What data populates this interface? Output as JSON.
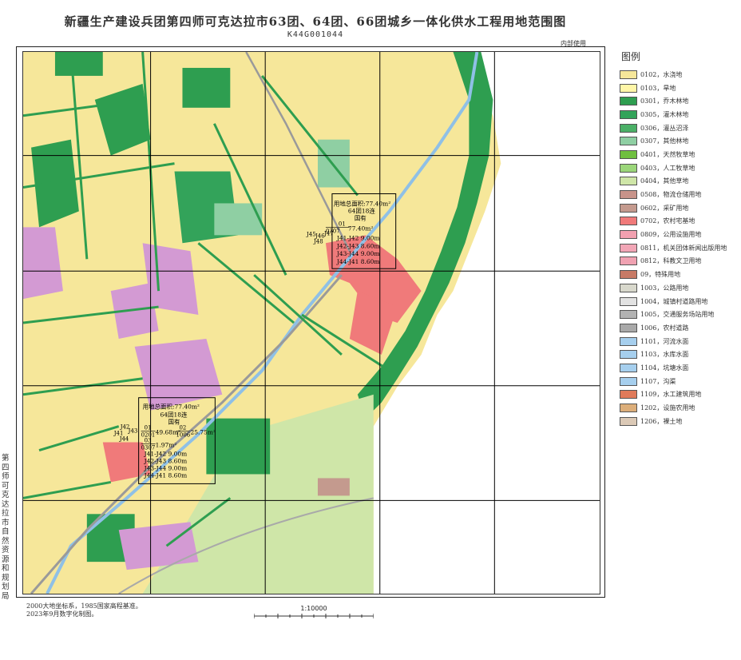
{
  "title": "新疆生产建设兵团第四师可克达拉市63团、64团、66团城乡一体化供水工程用地范围图",
  "map_code": "K44G001044",
  "internal_use": "内部使用",
  "side_authority": "第四师可克达拉市自然资源和规划局",
  "notes": [
    "2000大地坐标系，1985国家高程基准。",
    "2023年9月数字化制图。"
  ],
  "scale": "1:10000",
  "legend": {
    "title": "图例",
    "items": [
      {
        "code_label": "0102，水浇地",
        "color": "#f6e79a"
      },
      {
        "code_label": "0103，旱地",
        "color": "#fff6a8"
      },
      {
        "code_label": "0301，乔木林地",
        "color": "#2e9e50"
      },
      {
        "code_label": "0305，灌木林地",
        "color": "#33a35a"
      },
      {
        "code_label": "0306，灌丛沼泽",
        "color": "#4bb067"
      },
      {
        "code_label": "0307，其他林地",
        "color": "#8fcfa3"
      },
      {
        "code_label": "0401，天然牧草地",
        "color": "#6fbf3f"
      },
      {
        "code_label": "0403，人工牧草地",
        "color": "#9bd67a"
      },
      {
        "code_label": "0404，其他草地",
        "color": "#cfe6a8"
      },
      {
        "code_label": "0508，物流仓储用地",
        "color": "#c8938a"
      },
      {
        "code_label": "0602，采矿用地",
        "color": "#c49a8e"
      },
      {
        "code_label": "0702，农村宅基地",
        "color": "#f07a7a"
      },
      {
        "code_label": "0809，公用设施用地",
        "color": "#f2a0b0"
      },
      {
        "code_label": "0811，机关团体新闻出版用地",
        "color": "#f2a6b6"
      },
      {
        "code_label": "0812，科教文卫用地",
        "color": "#f0a2b2"
      },
      {
        "code_label": "09，特殊用地",
        "color": "#c87a66"
      },
      {
        "code_label": "1003，公路用地",
        "color": "#d8d8cc"
      },
      {
        "code_label": "1004，城镇村道路用地",
        "color": "#e2e2e2"
      },
      {
        "code_label": "1005，交通服务场站用地",
        "color": "#b2b2b2"
      },
      {
        "code_label": "1006，农村道路",
        "color": "#a9a9a9"
      },
      {
        "code_label": "1101，河流水面",
        "color": "#a6cfee"
      },
      {
        "code_label": "1103，水库水面",
        "color": "#a6cfee"
      },
      {
        "code_label": "1104，坑塘水面",
        "color": "#a6cfee"
      },
      {
        "code_label": "1107，沟渠",
        "color": "#a6cfee"
      },
      {
        "code_label": "1109，水工建筑用地",
        "color": "#e07a5a"
      },
      {
        "code_label": "1202，设施农用地",
        "color": "#dcae7a"
      },
      {
        "code_label": "1206，裸土地",
        "color": "#dbc9b6"
      }
    ]
  },
  "annotation_upper": {
    "area": "用地总面积:77.40m²",
    "unit": "64团18连",
    "ownership": "国有",
    "parcel_code": "01",
    "parcel_class": "0307",
    "parcel_area": "77.40m²",
    "points": [
      "J45",
      "J46",
      "J47",
      "J48"
    ],
    "distances": [
      "J41-J42 9.00m",
      "J42-J43 8.60m",
      "J43-J44 9.00m",
      "J44-J41 8.60m"
    ]
  },
  "annotation_lower": {
    "area": "用地总面积:77.40m²",
    "unit": "64团18连",
    "ownership": "国有",
    "parcels": [
      {
        "code": "01",
        "class": "0201",
        "area": "49.68m²"
      },
      {
        "code": "02",
        "class": "1006",
        "area": "25.75m²"
      },
      {
        "code": "03",
        "class": "0307",
        "area": "1.97m²"
      }
    ],
    "points": [
      "J41",
      "J42",
      "J43",
      "J44"
    ],
    "distances": [
      "J41-J42 9.00m",
      "J42-J43 8.60m",
      "J43-J44 9.00m",
      "J44-J41 8.60m"
    ]
  }
}
